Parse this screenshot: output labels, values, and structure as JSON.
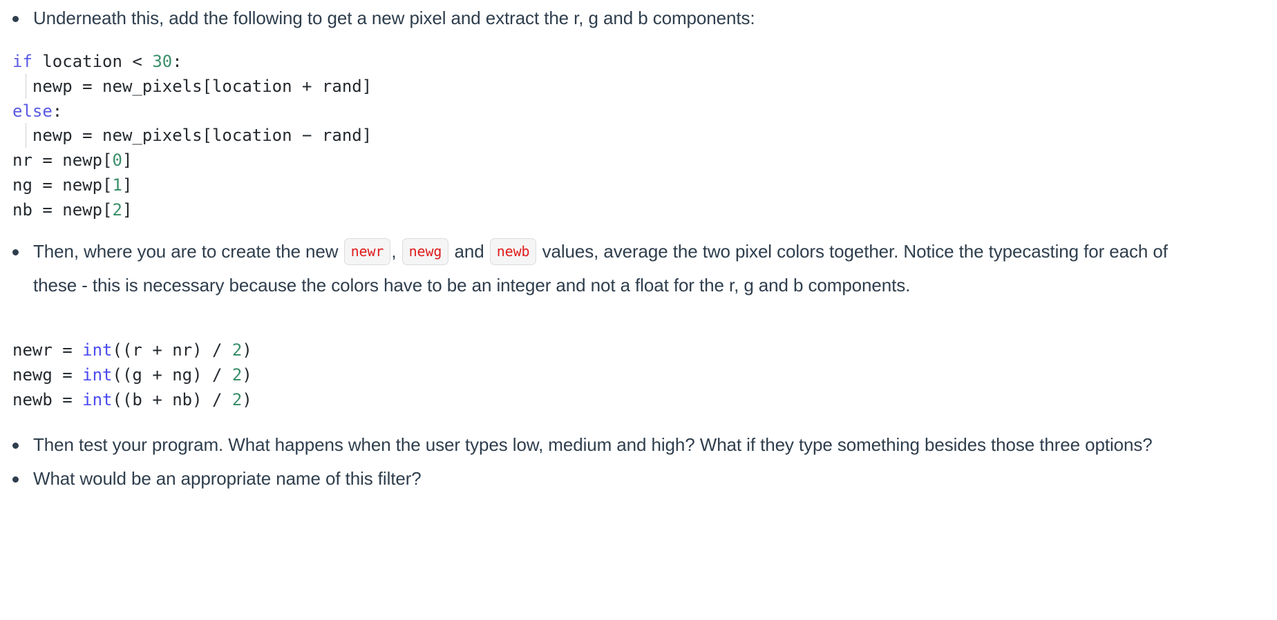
{
  "document": {
    "background_color": "#ffffff",
    "body_text_color": "#2f3e4d",
    "code_text_color": "#24292e",
    "keyword_color": "#5a5ae6",
    "number_color": "#3a8f6a",
    "builtin_color": "#4b4bf0",
    "inline_code_color": "#e01b1b",
    "inline_code_bg": "#f5f5f5",
    "inline_code_border": "#dcdcdc"
  },
  "bullets": {
    "b1": {
      "text": "Underneath this, add the following to get a new pixel and extract the r, g and b components:"
    },
    "b2": {
      "lead": "Then, where you are to create the new ",
      "code_newr": "newr",
      "sep_comma": ",",
      "code_newg": "newg",
      "sep_and": " and ",
      "code_newb": "newb",
      "tail": " values, average the two pixel colors together. Notice the typecasting for each of these - this is necessary because the colors have to be an integer and not a float for the r, g and b components."
    },
    "b3": {
      "text": "Then test your program. What happens when the user types low, medium and high? What if they type something besides those three options?"
    },
    "b4": {
      "text": "What would be an appropriate name of this filter?"
    }
  },
  "code_block_1": {
    "lines": [
      {
        "indented": false,
        "tokens": [
          {
            "t": "if",
            "c": "kw"
          },
          {
            "t": " location ",
            "c": "pl"
          },
          {
            "t": "< ",
            "c": "pl"
          },
          {
            "t": "30",
            "c": "num"
          },
          {
            "t": ":",
            "c": "pl"
          }
        ]
      },
      {
        "indented": true,
        "tokens": [
          {
            "t": "  newp = new_pixels[location + rand]",
            "c": "pl"
          }
        ]
      },
      {
        "indented": false,
        "tokens": [
          {
            "t": "else",
            "c": "kw"
          },
          {
            "t": ":",
            "c": "pl"
          }
        ]
      },
      {
        "indented": true,
        "tokens": [
          {
            "t": "  newp = new_pixels[location ",
            "c": "pl"
          },
          {
            "t": "−",
            "c": "pl"
          },
          {
            "t": " rand]",
            "c": "pl"
          }
        ]
      },
      {
        "indented": false,
        "tokens": [
          {
            "t": "nr = newp[",
            "c": "pl"
          },
          {
            "t": "0",
            "c": "num"
          },
          {
            "t": "]",
            "c": "pl"
          }
        ]
      },
      {
        "indented": false,
        "tokens": [
          {
            "t": "ng = newp[",
            "c": "pl"
          },
          {
            "t": "1",
            "c": "num"
          },
          {
            "t": "]",
            "c": "pl"
          }
        ]
      },
      {
        "indented": false,
        "tokens": [
          {
            "t": "nb = newp[",
            "c": "pl"
          },
          {
            "t": "2",
            "c": "num"
          },
          {
            "t": "]",
            "c": "pl"
          }
        ]
      }
    ]
  },
  "code_block_2": {
    "lines": [
      {
        "indented": false,
        "tokens": [
          {
            "t": "newr = ",
            "c": "pl"
          },
          {
            "t": "int",
            "c": "bi"
          },
          {
            "t": "((r + nr) / ",
            "c": "pl"
          },
          {
            "t": "2",
            "c": "num"
          },
          {
            "t": ")",
            "c": "pl"
          }
        ]
      },
      {
        "indented": false,
        "tokens": [
          {
            "t": "newg = ",
            "c": "pl"
          },
          {
            "t": "int",
            "c": "bi"
          },
          {
            "t": "((g + ng) / ",
            "c": "pl"
          },
          {
            "t": "2",
            "c": "num"
          },
          {
            "t": ")",
            "c": "pl"
          }
        ]
      },
      {
        "indented": false,
        "tokens": [
          {
            "t": "newb = ",
            "c": "pl"
          },
          {
            "t": "int",
            "c": "bi"
          },
          {
            "t": "((b + nb) / ",
            "c": "pl"
          },
          {
            "t": "2",
            "c": "num"
          },
          {
            "t": ")",
            "c": "pl"
          }
        ]
      }
    ]
  }
}
